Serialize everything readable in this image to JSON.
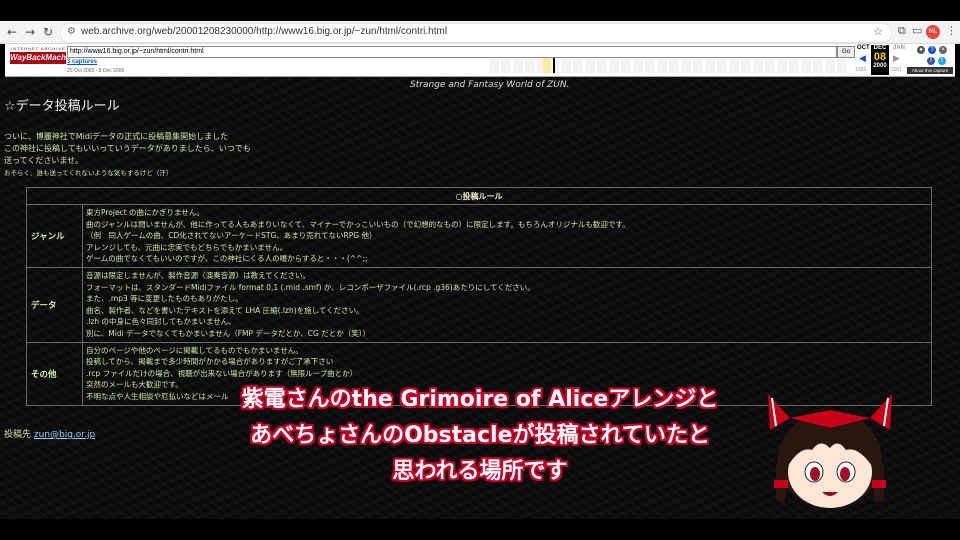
{
  "browser": {
    "url": "web.archive.org/web/20001208230000/http://www16.big.or.jp/~zun/html/contri.html",
    "profile_initials": "ML"
  },
  "wayback": {
    "logo_top": "INTERNET ARCHIVE",
    "logo": "WayBackMachine",
    "url_value": "http://www16.big.or.jp/~zun/html/contri.html",
    "go_label": "Go",
    "captures": "3 captures",
    "range": "20 Oct 2000 - 8 Dec 2000",
    "month_prev": "OCT",
    "month_cur": "DEC",
    "month_next": "JAN",
    "day": "08",
    "year_cur": "2000",
    "year_prev": "1999",
    "year_next": "2001",
    "about": "About this capture"
  },
  "page": {
    "banner": "Strange and Fantasy World of ZUN.",
    "title": "☆データ投稿ルール",
    "intro": [
      "ついに、博麗神社でMidiデータの正式に投稿募集開始しました",
      "この神社に投稿してもいいっていうデータがありましたら、いつでも",
      "送ってくださいませ。"
    ],
    "intro_small": "おそらく、誰も送ってくれないような気もするけど（汗）",
    "rules_header": "○投稿ルール",
    "rules": [
      {
        "label": "ジャンル",
        "lines": [
          "東方Project の曲にかぎりません。",
          "曲のジャンルは問いませんが、他に作ってる人もあまりいなくて、マイナーでかっこいいもの（で幻想的なもの）に限定します。もちろんオリジナルも歓迎です。",
          "（例　同人ゲームの曲、CD化されてないアーケードSTG、あまり売れてないRPG 他）",
          "アレンジしても、元曲に忠実でもどちらでもかまいません。",
          "ゲームの曲でなくてもいいのですが、この神社にくる人の嗜からすると・・・(^^;;"
        ]
      },
      {
        "label": "データ",
        "lines": [
          "音源は限定しませんが、製作音源（演奏音源）は教えてください。",
          "フォーマットは、スタンダードMidiファイル format 0,1 (.mid .smf) か、レコンポーザファイル(.rcp .g36)あたりにしてください。",
          "また、.mp3 等に変更したものもありがたし。",
          "曲名、製作者、などを書いたテキストを添えて LHA 圧縮(.lzh)を施してください。",
          ".lzh の中身に色々同封してもかまいません。",
          "別に、Midi データでなくてもかまいません（FMP データだとか、CG だとか（笑））"
        ]
      },
      {
        "label": "その他",
        "lines": [
          "自分のページや他のページに掲載してるものでもかまいません。",
          "投稿してから、掲載まで多少時間がかかる場合がありますがご了承下さい",
          ".rcp ファイルだけの場合、視聴が出来ない場合があります（無限ループ曲とか）",
          "突然のメールも大歓迎です。",
          "不明な点や人生相談や厄払いなどはメール"
        ]
      }
    ],
    "contact_label": "投稿先",
    "contact_email": "zun@big.or.jp"
  },
  "subtitle": [
    "紫電さんのthe Grimoire of Aliceアレンジと",
    "あべちょさんのObstacleが投稿されていたと",
    "思われる場所です"
  ],
  "colors": {
    "subtitle_outline": "#c4002a",
    "page_text": "#cfe8a0",
    "link": "#8fd0ff"
  }
}
